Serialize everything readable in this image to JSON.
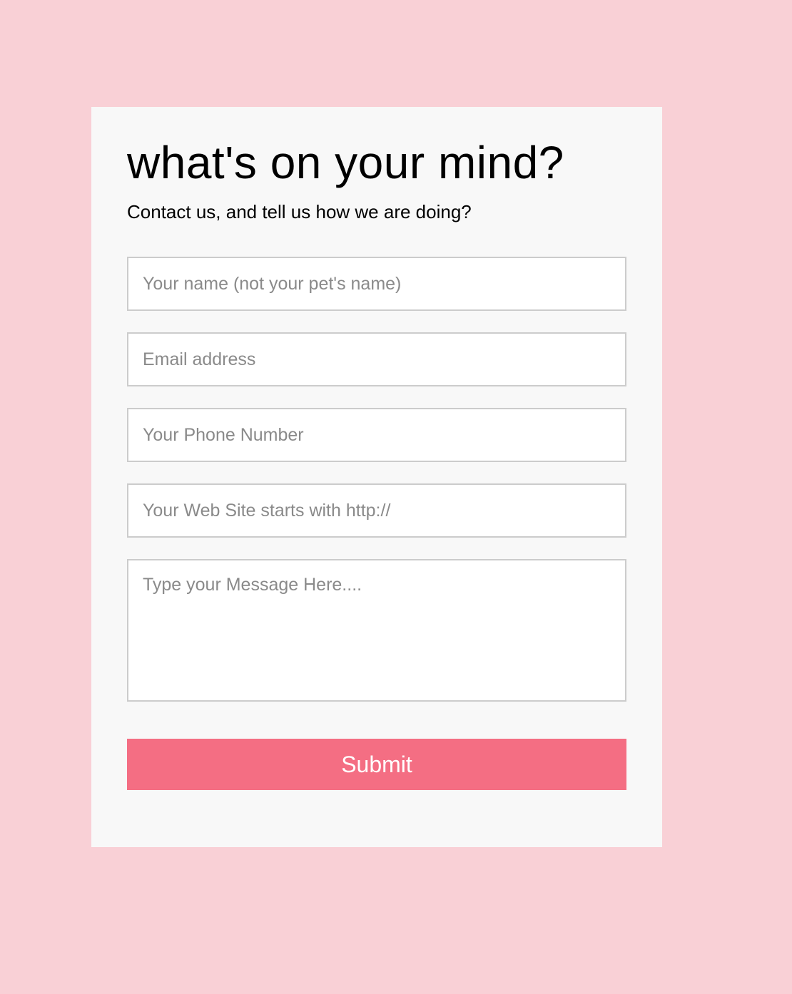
{
  "contact_form": {
    "title": "what's on your mind?",
    "subtitle": "Contact us, and tell us how we are doing?",
    "fields": {
      "name_placeholder": "Your name (not your pet's name)",
      "email_placeholder": "Email address",
      "phone_placeholder": "Your Phone Number",
      "website_placeholder": "Your Web Site starts with http://",
      "message_placeholder": "Type your Message Here...."
    },
    "submit_label": "Submit"
  },
  "colors": {
    "page_background": "#f9d0d6",
    "card_background": "#f8f8f8",
    "submit_background": "#f46e83",
    "input_border": "#cccccc",
    "placeholder_text": "#8a8a8a"
  }
}
